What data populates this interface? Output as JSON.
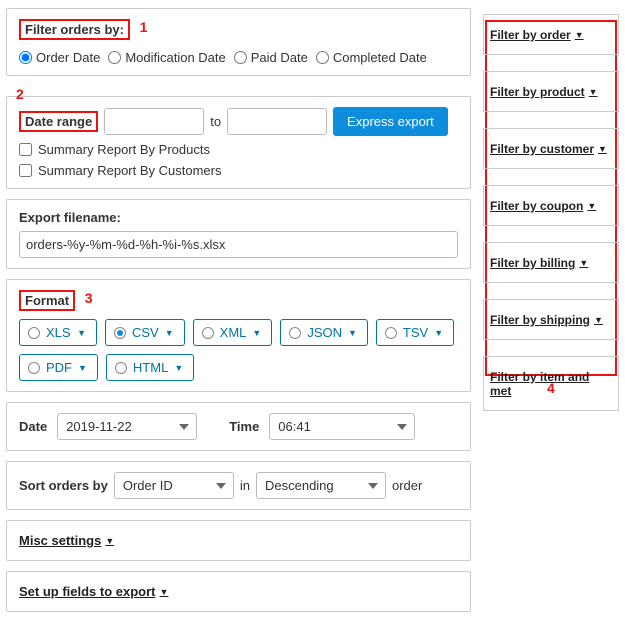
{
  "annotations": {
    "a1": "1",
    "a2": "2",
    "a3": "3",
    "a4": "4"
  },
  "filter_orders": {
    "heading": "Filter orders by:",
    "options": {
      "order_date": "Order Date",
      "modification_date": "Modification Date",
      "paid_date": "Paid Date",
      "completed_date": "Completed Date"
    }
  },
  "date_range": {
    "label": "Date range",
    "to": "to",
    "express_btn": "Express export",
    "summary_products": "Summary Report By Products",
    "summary_customers": "Summary Report By Customers"
  },
  "filename": {
    "label": "Export filename:",
    "value": "orders-%y-%m-%d-%h-%i-%s.xlsx"
  },
  "format": {
    "heading": "Format",
    "options": {
      "xls": "XLS",
      "csv": "CSV",
      "xml": "XML",
      "json": "JSON",
      "tsv": "TSV",
      "pdf": "PDF",
      "html": "HTML"
    }
  },
  "datetime": {
    "date_label": "Date",
    "date_value": "2019-11-22",
    "time_label": "Time",
    "time_value": "06:41"
  },
  "sort": {
    "label": "Sort orders by",
    "by_value": "Order ID",
    "in": "in",
    "dir_value": "Descending",
    "suffix": "order"
  },
  "misc": {
    "label": "Misc settings"
  },
  "setup_fields": {
    "label": "Set up fields to export"
  },
  "sidebar": {
    "order": "Filter by order",
    "product": "Filter by product",
    "customer": "Filter by customer",
    "coupon": "Filter by coupon",
    "billing": "Filter by billing",
    "shipping": "Filter by shipping",
    "item_meta": "Filter by item and met"
  }
}
